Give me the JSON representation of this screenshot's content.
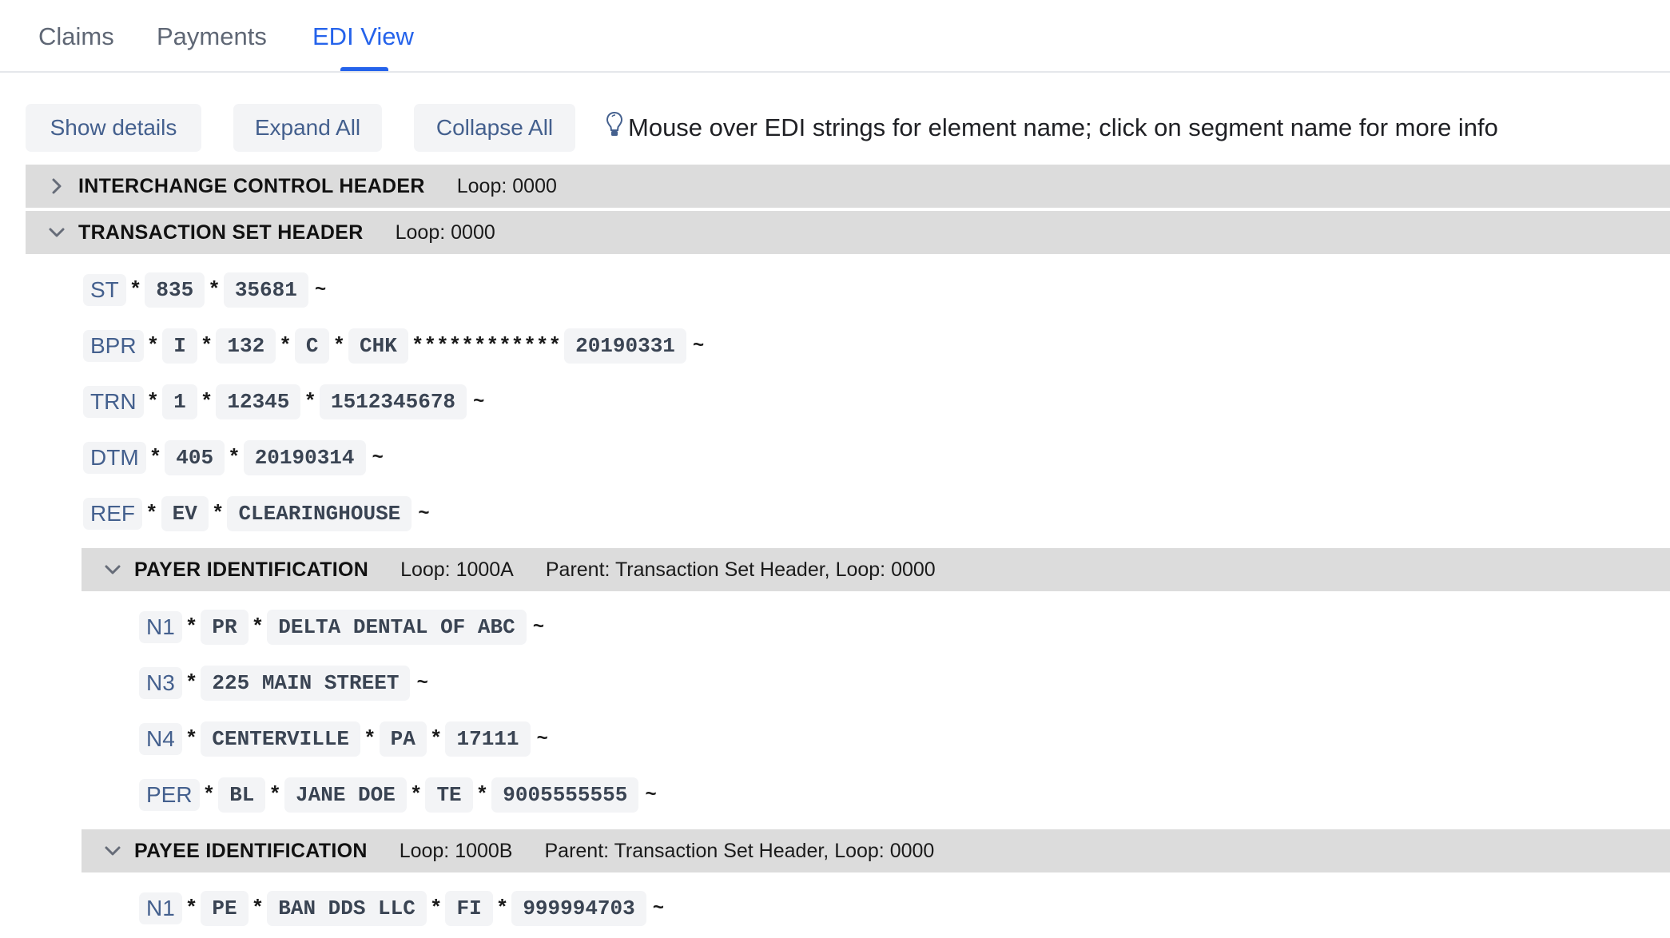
{
  "tabs": [
    {
      "label": "Claims",
      "active": false
    },
    {
      "label": "Payments",
      "active": false
    },
    {
      "label": "EDI View",
      "active": true
    }
  ],
  "toolbar": {
    "show_details_label": "Show details",
    "expand_all_label": "Expand All",
    "collapse_all_label": "Collapse All",
    "hint_icon": "lightbulb-icon",
    "hint_text": "Mouse over EDI strings for element name; click on segment name for more info"
  },
  "colors": {
    "accent": "#2563eb",
    "loop_header_bg": "#dcdcdc",
    "chip_bg": "#f3f4f6",
    "segment_id": "#44608e"
  },
  "loops": {
    "interchange": {
      "name": "INTERCHANGE CONTROL HEADER",
      "meta": "Loop: 0000",
      "expanded": false,
      "chevron_icon": "chevron-right-icon"
    },
    "transaction": {
      "name": "TRANSACTION SET HEADER",
      "meta": "Loop: 0000",
      "expanded": true,
      "chevron_icon": "chevron-down-icon"
    },
    "payer": {
      "name": "PAYER IDENTIFICATION",
      "meta": "Loop: 1000A",
      "parent": "Parent: Transaction Set Header, Loop: 0000",
      "expanded": true,
      "chevron_icon": "chevron-down-icon"
    },
    "payee": {
      "name": "PAYEE IDENTIFICATION",
      "meta": "Loop: 1000B",
      "parent": "Parent: Transaction Set Header, Loop: 0000",
      "expanded": true,
      "chevron_icon": "chevron-down-icon"
    }
  },
  "segments": {
    "separator": "*",
    "terminator": "~",
    "transaction": [
      {
        "id": "ST",
        "parts": [
          {
            "el": "835"
          },
          {
            "sep": "*"
          },
          {
            "el": "35681"
          }
        ]
      },
      {
        "id": "BPR",
        "parts": [
          {
            "el": "I"
          },
          {
            "sep": "*"
          },
          {
            "el": "132"
          },
          {
            "sep": "*"
          },
          {
            "el": "C"
          },
          {
            "sep": "*"
          },
          {
            "el": "CHK"
          },
          {
            "sep": "************"
          },
          {
            "el": "20190331"
          }
        ]
      },
      {
        "id": "TRN",
        "parts": [
          {
            "el": "1"
          },
          {
            "sep": "*"
          },
          {
            "el": "12345"
          },
          {
            "sep": "*"
          },
          {
            "el": "1512345678"
          }
        ]
      },
      {
        "id": "DTM",
        "parts": [
          {
            "el": "405"
          },
          {
            "sep": "*"
          },
          {
            "el": "20190314"
          }
        ]
      },
      {
        "id": "REF",
        "parts": [
          {
            "el": "EV"
          },
          {
            "sep": "*"
          },
          {
            "el": "CLEARINGHOUSE"
          }
        ]
      }
    ],
    "payer": [
      {
        "id": "N1",
        "parts": [
          {
            "el": "PR"
          },
          {
            "sep": "*"
          },
          {
            "el": "DELTA DENTAL OF ABC"
          }
        ]
      },
      {
        "id": "N3",
        "parts": [
          {
            "el": "225 MAIN STREET"
          }
        ]
      },
      {
        "id": "N4",
        "parts": [
          {
            "el": "CENTERVILLE"
          },
          {
            "sep": "*"
          },
          {
            "el": "PA"
          },
          {
            "sep": "*"
          },
          {
            "el": "17111"
          }
        ]
      },
      {
        "id": "PER",
        "parts": [
          {
            "el": "BL"
          },
          {
            "sep": "*"
          },
          {
            "el": "JANE DOE"
          },
          {
            "sep": "*"
          },
          {
            "el": "TE"
          },
          {
            "sep": "*"
          },
          {
            "el": "9005555555"
          }
        ]
      }
    ],
    "payee": [
      {
        "id": "N1",
        "parts": [
          {
            "el": "PE"
          },
          {
            "sep": "*"
          },
          {
            "el": "BAN DDS LLC"
          },
          {
            "sep": "*"
          },
          {
            "el": "FI"
          },
          {
            "sep": "*"
          },
          {
            "el": "999994703"
          }
        ]
      }
    ]
  }
}
